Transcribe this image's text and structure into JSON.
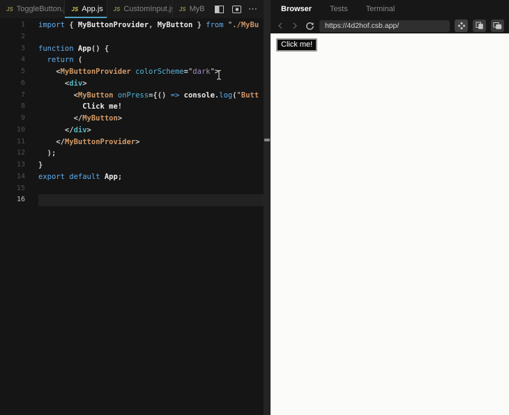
{
  "colors": {
    "accent": "#4fa3c7",
    "kw": "#61aeee",
    "cmp": "#d19a66",
    "str": "#cf9365",
    "attr": "#56b3d8",
    "tag": "#56b6c2",
    "jsxstr": "#a08cc0",
    "js_badge_active": "#d5c84b",
    "editor_bg": "#151515",
    "preview_page_bg": "#fbfbf9",
    "page_button_bg": "#0c0c0c"
  },
  "editor": {
    "js_badge": "JS",
    "more_label": "⋯",
    "tabs": [
      {
        "label": "ToggleButton.js",
        "active": false,
        "closable": false
      },
      {
        "label": "App.js",
        "active": true,
        "closable": true,
        "close_label": "×"
      },
      {
        "label": "CustomInput.js",
        "active": false,
        "closable": false
      },
      {
        "label": "MyB",
        "active": false,
        "closable": false,
        "truncated": true
      }
    ],
    "active_line": 16,
    "code_lines": [
      {
        "n": 1,
        "tokens": [
          [
            "kw",
            "import "
          ],
          [
            "pun",
            "{ "
          ],
          [
            "id",
            "MyButtonProvider"
          ],
          [
            "pun",
            ", "
          ],
          [
            "id",
            "MyButton"
          ],
          [
            "pun",
            " } "
          ],
          [
            "kw",
            "from "
          ],
          [
            "strq",
            "\""
          ],
          [
            "str",
            "./MyBu"
          ]
        ]
      },
      {
        "n": 2,
        "tokens": []
      },
      {
        "n": 3,
        "tokens": [
          [
            "kw",
            "function "
          ],
          [
            "id",
            "App"
          ],
          [
            "pun",
            "() {"
          ]
        ]
      },
      {
        "n": 4,
        "tokens": [
          [
            "pun",
            "  "
          ],
          [
            "kw",
            "return"
          ],
          [
            "pun",
            " ("
          ]
        ]
      },
      {
        "n": 5,
        "tokens": [
          [
            "pun",
            "    <"
          ],
          [
            "cmp",
            "MyButtonProvider"
          ],
          [
            "pun",
            " "
          ],
          [
            "attr",
            "colorScheme"
          ],
          [
            "pun",
            "="
          ],
          [
            "strq",
            "\""
          ],
          [
            "purple",
            "dark"
          ],
          [
            "strq",
            "\""
          ],
          [
            "pun",
            ">"
          ]
        ]
      },
      {
        "n": 6,
        "tokens": [
          [
            "pun",
            "      <"
          ],
          [
            "tag",
            "div"
          ],
          [
            "pun",
            ">"
          ]
        ]
      },
      {
        "n": 7,
        "tokens": [
          [
            "pun",
            "        <"
          ],
          [
            "cmp",
            "MyButton"
          ],
          [
            "pun",
            " "
          ],
          [
            "attr",
            "onPress"
          ],
          [
            "pun",
            "={() "
          ],
          [
            "kw",
            "=> "
          ],
          [
            "id",
            "console"
          ],
          [
            "pun",
            "."
          ],
          [
            "prop",
            "log"
          ],
          [
            "pun",
            "("
          ],
          [
            "strq",
            "\""
          ],
          [
            "str",
            "Butt"
          ]
        ]
      },
      {
        "n": 8,
        "tokens": [
          [
            "plain",
            "          Click me!"
          ]
        ]
      },
      {
        "n": 9,
        "tokens": [
          [
            "pun",
            "        </"
          ],
          [
            "cmp",
            "MyButton"
          ],
          [
            "pun",
            ">"
          ]
        ]
      },
      {
        "n": 10,
        "tokens": [
          [
            "pun",
            "      </"
          ],
          [
            "tag",
            "div"
          ],
          [
            "pun",
            ">"
          ]
        ]
      },
      {
        "n": 11,
        "tokens": [
          [
            "pun",
            "    </"
          ],
          [
            "cmp",
            "MyButtonProvider"
          ],
          [
            "pun",
            ">"
          ]
        ]
      },
      {
        "n": 12,
        "tokens": [
          [
            "pun",
            "  );"
          ]
        ]
      },
      {
        "n": 13,
        "tokens": [
          [
            "pun",
            "}"
          ]
        ]
      },
      {
        "n": 14,
        "tokens": [
          [
            "kw",
            "export "
          ],
          [
            "kw",
            "default "
          ],
          [
            "id",
            "App"
          ],
          [
            "pun",
            ";"
          ]
        ]
      },
      {
        "n": 15,
        "tokens": []
      },
      {
        "n": 16,
        "tokens": []
      }
    ]
  },
  "preview": {
    "tabs": [
      {
        "label": "Browser",
        "active": true
      },
      {
        "label": "Tests",
        "active": false
      },
      {
        "label": "Terminal",
        "active": false
      }
    ],
    "url": "https://4d2hof.csb.app/",
    "page": {
      "button_label": "Click me!"
    }
  }
}
